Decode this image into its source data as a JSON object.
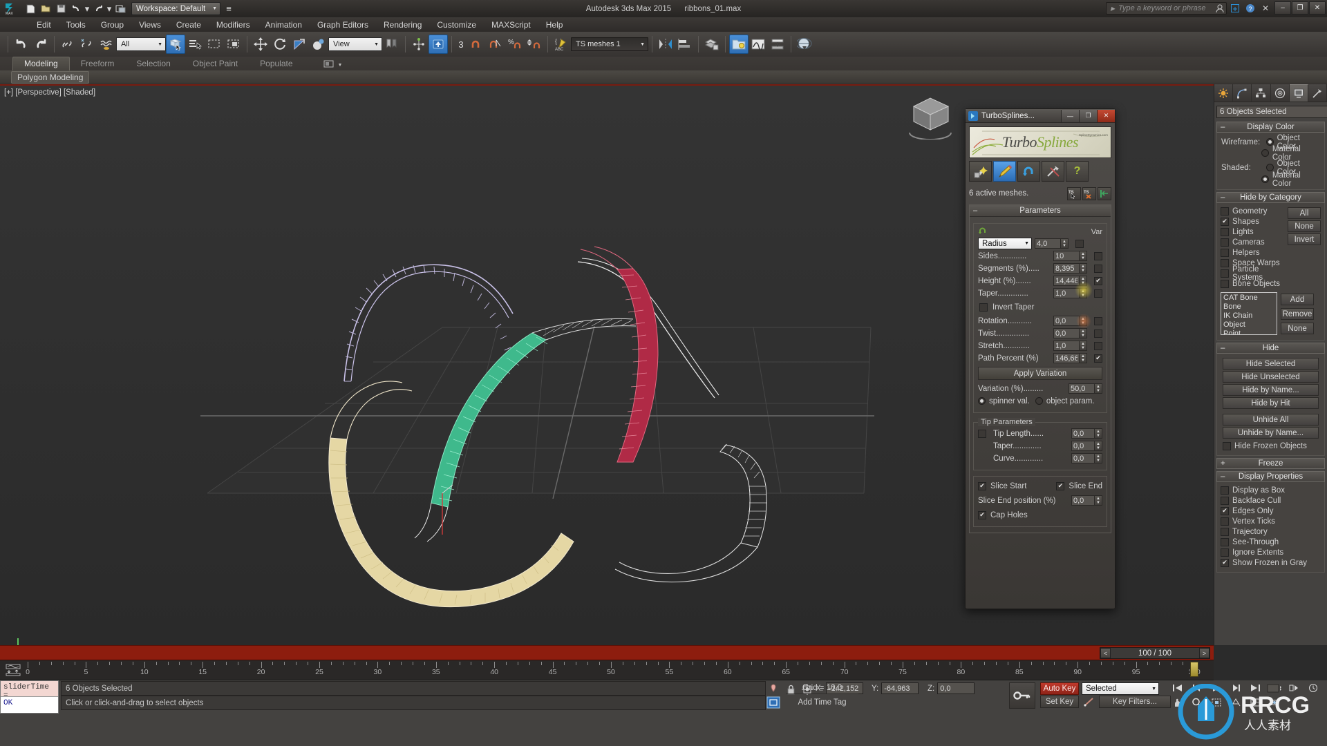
{
  "titlebar": {
    "app_title": "Autodesk 3ds Max  2015",
    "file_name": "ribbons_01.max",
    "workspace": "Workspace: Default",
    "search_placeholder": "Type a keyword or phrase",
    "minimize": "–",
    "maximize": "❐",
    "close": "✕"
  },
  "menubar": {
    "items": [
      "Edit",
      "Tools",
      "Group",
      "Views",
      "Create",
      "Modifiers",
      "Animation",
      "Graph Editors",
      "Rendering",
      "Customize",
      "MAXScript",
      "Help"
    ]
  },
  "toolbar": {
    "selection_filter": "All",
    "ref_coord_system": "View",
    "named_selection_set": "TS meshes 1",
    "snap_degrees": "3"
  },
  "ribbon": {
    "tabs": [
      {
        "label": "Modeling",
        "selected": true
      },
      {
        "label": "Freeform",
        "selected": false
      },
      {
        "label": "Selection",
        "selected": false
      },
      {
        "label": "Object Paint",
        "selected": false
      },
      {
        "label": "Populate",
        "selected": false
      }
    ],
    "subtab": "Polygon Modeling"
  },
  "viewport": {
    "label": "[+] [Perspective] [Shaded]",
    "ribbons": [
      {
        "name": "ribbon-lavender",
        "color": "#c9c1e8"
      },
      {
        "name": "ribbon-green",
        "color": "#4ec79a"
      },
      {
        "name": "ribbon-crimson",
        "color": "#c1304f"
      },
      {
        "name": "ribbon-tan",
        "color": "#e8d9a8"
      },
      {
        "name": "ribbon-white-left",
        "color": "#f0f0f0"
      },
      {
        "name": "ribbon-white-right",
        "color": "#f0f0f0"
      }
    ]
  },
  "turbosplines": {
    "title": "TurboSplines...",
    "logo_turbo": "Turbo",
    "logo_splines": "Splines",
    "logo_sub": "SplineDynamics.com",
    "tools": [
      {
        "name": "create-icon",
        "glyph": "✨",
        "selected": false
      },
      {
        "name": "edit-pencil-icon",
        "glyph": "✎",
        "selected": true
      },
      {
        "name": "update-refresh-icon",
        "glyph": "↻",
        "selected": false
      },
      {
        "name": "tools-hammer-icon",
        "glyph": "⚒",
        "selected": false
      },
      {
        "name": "help-icon",
        "glyph": "?",
        "selected": false
      }
    ],
    "status": "6 active meshes.",
    "mini_buttons": [
      "TS",
      "TS",
      "|←"
    ],
    "rollout_title": "Parameters",
    "var_header": "Var",
    "param_select": "Radius",
    "params": [
      {
        "label": "Radius",
        "value": "4,0",
        "var": false,
        "is_dropdown": true
      },
      {
        "label": "Sides.............",
        "value": "10",
        "var": false
      },
      {
        "label": "Segments (%).....",
        "value": "8,395",
        "var": false
      },
      {
        "label": "Height (%).......",
        "value": "14,446",
        "var": true
      },
      {
        "label": "Taper..............",
        "value": "1,0",
        "var": false
      }
    ],
    "invert_taper": {
      "label": "Invert Taper",
      "checked": false
    },
    "params2": [
      {
        "label": "Rotation...........",
        "value": "0,0",
        "var": false
      },
      {
        "label": "Twist...............",
        "value": "0,0",
        "var": false
      },
      {
        "label": "Stretch............",
        "value": "1,0",
        "var": false
      },
      {
        "label": "Path Percent (%)",
        "value": "146,66",
        "var": true
      }
    ],
    "apply_variation": "Apply Variation",
    "variation_label": "Variation (%).........",
    "variation_value": "50,0",
    "radio_spinner": "spinner val.",
    "radio_object": "object param.",
    "radio_selected": "spinner",
    "tip_group_title": "Tip Parameters",
    "tip_length": {
      "label": "Tip Length......",
      "value": "0,0",
      "checked": false
    },
    "tip_taper": {
      "label": "Taper.............",
      "value": "0,0"
    },
    "tip_curve": {
      "label": "Curve.............",
      "value": "0,0"
    },
    "slice_start": {
      "label": "Slice Start",
      "checked": true
    },
    "slice_end": {
      "label": "Slice End",
      "checked": true
    },
    "slice_end_pos": {
      "label": "Slice End position (%)",
      "value": "0,0"
    },
    "cap_holes": {
      "label": "Cap Holes",
      "checked": true
    }
  },
  "command_panel": {
    "tabs": [
      {
        "name": "create-tab",
        "glyph": "☀",
        "selected": false
      },
      {
        "name": "modify-tab",
        "glyph": "◠",
        "selected": false
      },
      {
        "name": "hierarchy-tab",
        "glyph": "⑂",
        "selected": false
      },
      {
        "name": "motion-tab",
        "glyph": "◎",
        "selected": false
      },
      {
        "name": "display-tab",
        "glyph": "▣",
        "selected": true
      },
      {
        "name": "utilities-tab",
        "glyph": "⚒",
        "selected": false
      }
    ],
    "object_name": "6 Objects Selected",
    "display_color": {
      "title": "Display Color",
      "wireframe_label": "Wireframe:",
      "shaded_label": "Shaded:",
      "object_color": "Object Color",
      "material_color": "Material Color",
      "wireframe_selected": "object",
      "shaded_selected": "material"
    },
    "hide_by_category": {
      "title": "Hide by Category",
      "items": [
        {
          "label": "Geometry",
          "checked": false
        },
        {
          "label": "Shapes",
          "checked": true
        },
        {
          "label": "Lights",
          "checked": false
        },
        {
          "label": "Cameras",
          "checked": false
        },
        {
          "label": "Helpers",
          "checked": false
        },
        {
          "label": "Space Warps",
          "checked": false
        },
        {
          "label": "Particle Systems",
          "checked": false
        },
        {
          "label": "Bone Objects",
          "checked": false
        }
      ],
      "buttons": [
        "All",
        "None",
        "Invert"
      ],
      "list_items": [
        "CAT Bone",
        "Bone",
        "IK Chain Object",
        "Point"
      ],
      "side_buttons": [
        "Add",
        "Remove",
        "None"
      ]
    },
    "hide": {
      "title": "Hide",
      "buttons": [
        "Hide Selected",
        "Hide Unselected",
        "Hide by Name...",
        "Hide by Hit",
        "Unhide All",
        "Unhide by Name..."
      ],
      "hide_frozen": {
        "label": "Hide Frozen Objects",
        "checked": false
      }
    },
    "freeze": {
      "title": "Freeze"
    },
    "display_properties": {
      "title": "Display Properties",
      "items": [
        {
          "label": "Display as Box",
          "checked": false
        },
        {
          "label": "Backface Cull",
          "checked": false
        },
        {
          "label": "Edges Only",
          "checked": true
        },
        {
          "label": "Vertex Ticks",
          "checked": false
        },
        {
          "label": "Trajectory",
          "checked": false
        },
        {
          "label": "See-Through",
          "checked": false
        },
        {
          "label": "Ignore Extents",
          "checked": false
        },
        {
          "label": "Show Frozen in Gray",
          "checked": true
        }
      ]
    }
  },
  "timeline": {
    "current_frame": "100 / 100",
    "prev": "<",
    "next": ">",
    "tick_labels": [
      "0",
      "5",
      "10",
      "15",
      "20",
      "25",
      "30",
      "35",
      "40",
      "45",
      "50",
      "55",
      "60",
      "65",
      "70",
      "75",
      "80",
      "85",
      "90",
      "95",
      "100"
    ],
    "playhead_frame": 100
  },
  "statusbar": {
    "listener_top": "sliderTime =",
    "listener_bottom": "OK",
    "selection_status": "6 Objects Selected",
    "prompt": "Click or click-and-drag to select objects",
    "x_label": "X:",
    "x_value": "-142,152",
    "y_label": "Y:",
    "y_value": "-64,963",
    "z_label": "Z:",
    "z_value": "0,0",
    "grid": "Grid = 10,0",
    "add_time_tag": "Add Time Tag",
    "auto_key": "Auto Key",
    "set_key": "Set Key",
    "key_mode": "Selected",
    "key_filters": "Key Filters..."
  },
  "watermark": {
    "text_main": "RRCG",
    "text_sub": "人人素材"
  }
}
